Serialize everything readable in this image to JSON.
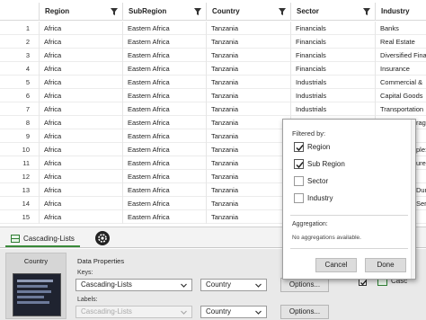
{
  "grid": {
    "headers": {
      "region": "Region",
      "subregion": "SubRegion",
      "country": "Country",
      "sector": "Sector",
      "industry": "Industry"
    },
    "rows": [
      {
        "n": "1",
        "region": "Africa",
        "sub": "Eastern Africa",
        "country": "Tanzania",
        "sector": "Financials",
        "industry": "Banks"
      },
      {
        "n": "2",
        "region": "Africa",
        "sub": "Eastern Africa",
        "country": "Tanzania",
        "sector": "Financials",
        "industry": "Real Estate"
      },
      {
        "n": "3",
        "region": "Africa",
        "sub": "Eastern Africa",
        "country": "Tanzania",
        "sector": "Financials",
        "industry": "Diversified Fina"
      },
      {
        "n": "4",
        "region": "Africa",
        "sub": "Eastern Africa",
        "country": "Tanzania",
        "sector": "Financials",
        "industry": "Insurance"
      },
      {
        "n": "5",
        "region": "Africa",
        "sub": "Eastern Africa",
        "country": "Tanzania",
        "sector": "Industrials",
        "industry": "Commercial &"
      },
      {
        "n": "6",
        "region": "Africa",
        "sub": "Eastern Africa",
        "country": "Tanzania",
        "sector": "Industrials",
        "industry": "Capital Goods"
      },
      {
        "n": "7",
        "region": "Africa",
        "sub": "Eastern Africa",
        "country": "Tanzania",
        "sector": "Industrials",
        "industry": "Transportation"
      },
      {
        "n": "8",
        "region": "Africa",
        "sub": "Eastern Africa",
        "country": "Tanzania",
        "sector": "",
        "industry": ""
      },
      {
        "n": "9",
        "region": "Africa",
        "sub": "Eastern Africa",
        "country": "Tanzania",
        "sector": "",
        "industry": ""
      },
      {
        "n": "10",
        "region": "Africa",
        "sub": "Eastern Africa",
        "country": "Tanzania",
        "sector": "",
        "industry": ""
      },
      {
        "n": "11",
        "region": "Africa",
        "sub": "Eastern Africa",
        "country": "Tanzania",
        "sector": "",
        "industry": ""
      },
      {
        "n": "12",
        "region": "Africa",
        "sub": "Eastern Africa",
        "country": "Tanzania",
        "sector": "",
        "industry": ""
      },
      {
        "n": "13",
        "region": "Africa",
        "sub": "Eastern Africa",
        "country": "Tanzania",
        "sector": "",
        "industry": ""
      },
      {
        "n": "14",
        "region": "Africa",
        "sub": "Eastern Africa",
        "country": "Tanzania",
        "sector": "",
        "industry": ""
      },
      {
        "n": "15",
        "region": "Africa",
        "sub": "Eastern Africa",
        "country": "Tanzania",
        "sector": "",
        "industry": ""
      }
    ],
    "partial_right": {
      "r8": "rag",
      "r10": "ple:",
      "r11": "ure",
      "r13": "Dur",
      "r14": "Ser"
    }
  },
  "tab": {
    "label": "Cascading-Lists"
  },
  "bottom": {
    "country_card_title": "Country",
    "data_properties_title": "Data Properties",
    "keys_label": "Keys:",
    "labels_label": "Labels:",
    "keys_list": "Cascading-Lists",
    "keys_field": "Country",
    "labels_list": "Cascading-Lists",
    "labels_field": "Country",
    "options_label": "Options...",
    "right_label": "Casc"
  },
  "popup": {
    "filtered_by": "Filtered by:",
    "items": [
      {
        "label": "Region",
        "checked": true
      },
      {
        "label": "Sub Region",
        "checked": true
      },
      {
        "label": "Sector",
        "checked": false
      },
      {
        "label": "Industry",
        "checked": false
      }
    ],
    "aggregation_title": "Aggregation:",
    "aggregation_value": "No aggregations available.",
    "cancel": "Cancel",
    "done": "Done"
  }
}
